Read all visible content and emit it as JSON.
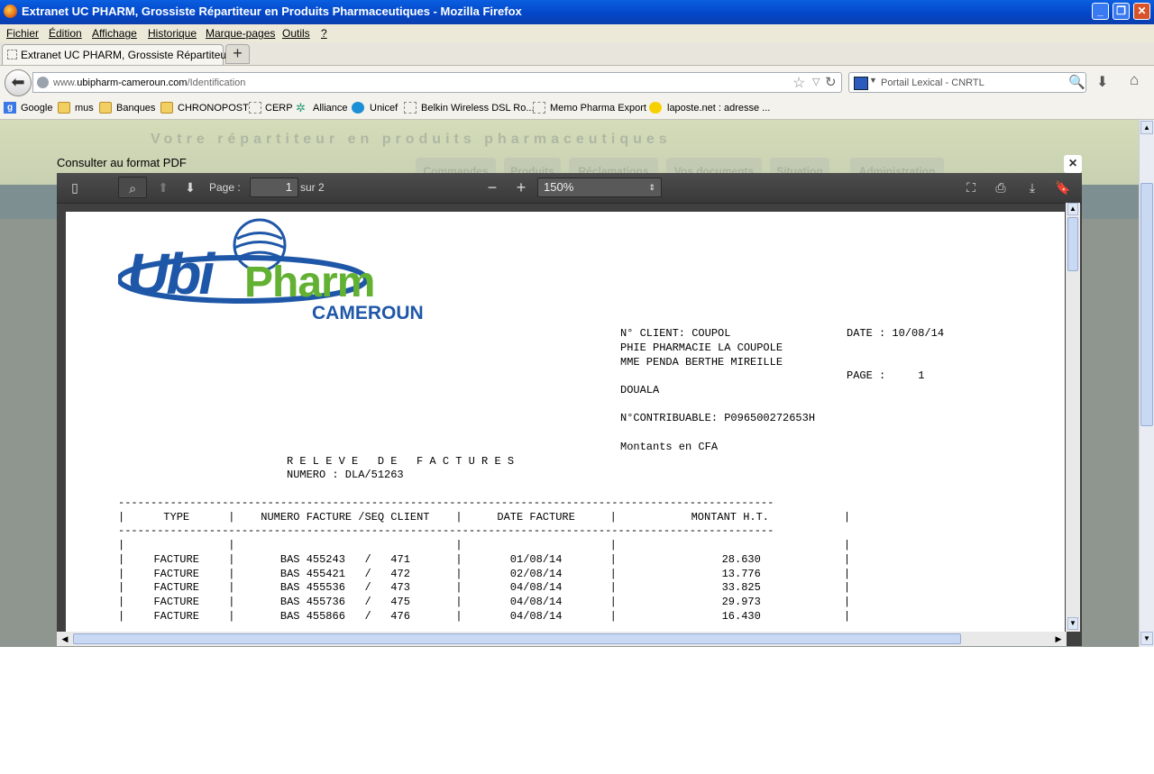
{
  "window": {
    "title": "Extranet UC PHARM, Grossiste Répartiteur en Produits Pharmaceutiques - Mozilla Firefox",
    "minimize": "_",
    "maximize": "❐",
    "close": "✕"
  },
  "menu": {
    "items": [
      "Fichier",
      "Édition",
      "Affichage",
      "Historique",
      "Marque-pages",
      "Outils",
      "?"
    ]
  },
  "tab": {
    "label": "Extranet UC PHARM, Grossiste Répartiteur ...",
    "new_tab": "+"
  },
  "nav": {
    "url_prefix": "www.",
    "url_domain": "ubipharm-cameroun.com",
    "url_path": "/Identification",
    "search_placeholder": "Portail Lexical - CNRTL"
  },
  "bookmarks": [
    "Google",
    "mus",
    "Banques",
    "CHRONOPOST",
    "CERP",
    "Alliance",
    "Unicef",
    "Belkin Wireless DSL Ro...",
    "Memo Pharma Export",
    "laposte.net : adresse ..."
  ],
  "site": {
    "tagline": "Votre répartiteur en produits pharmaceutiques",
    "tabs": [
      "Commandes",
      "Produits",
      "Réclamations",
      "Vos documents",
      "Situation",
      "Administration"
    ]
  },
  "overlay": {
    "title": "Consulter au format PDF",
    "close": "×"
  },
  "pdf_toolbar": {
    "page_label": "Page :",
    "page_current": "1",
    "page_total": "sur 2",
    "zoom": "150%"
  },
  "document": {
    "logo_main": "UbiPharm",
    "logo_sub": "CAMEROUN",
    "client_line": "N° CLIENT: COUPOL",
    "date_line": "DATE : 10/08/14",
    "name_line1": "PHIE PHARMACIE LA COUPOLE",
    "name_line2": "MME PENDA BERTHE MIREILLE",
    "page_line": "PAGE :     1",
    "city": "DOUALA",
    "contribuable": "N°CONTRIBUABLE: P096500272653H",
    "currency": "Montants en CFA",
    "heading": "R E L E V E   D E   F A C T U R E S",
    "numero": "NUMERO : DLA/51263",
    "columns": [
      "TYPE",
      "NUMERO FACTURE /SEQ CLIENT",
      "DATE FACTURE",
      "MONTANT H.T."
    ],
    "rows": [
      {
        "type": "FACTURE",
        "numero": "BAS 455243",
        "seq": "471",
        "date": "01/08/14",
        "montant": "28.630"
      },
      {
        "type": "FACTURE",
        "numero": "BAS 455421",
        "seq": "472",
        "date": "02/08/14",
        "montant": "13.776"
      },
      {
        "type": "FACTURE",
        "numero": "BAS 455536",
        "seq": "473",
        "date": "04/08/14",
        "montant": "33.825"
      },
      {
        "type": "FACTURE",
        "numero": "BAS 455736",
        "seq": "475",
        "date": "04/08/14",
        "montant": "29.973"
      },
      {
        "type": "FACTURE",
        "numero": "BAS 455866",
        "seq": "476",
        "date": "04/08/14",
        "montant": "16.430"
      }
    ]
  },
  "colors": {
    "titlebar": "#0347c9",
    "logo_blue": "#1f57a8",
    "logo_green": "#62b132"
  }
}
